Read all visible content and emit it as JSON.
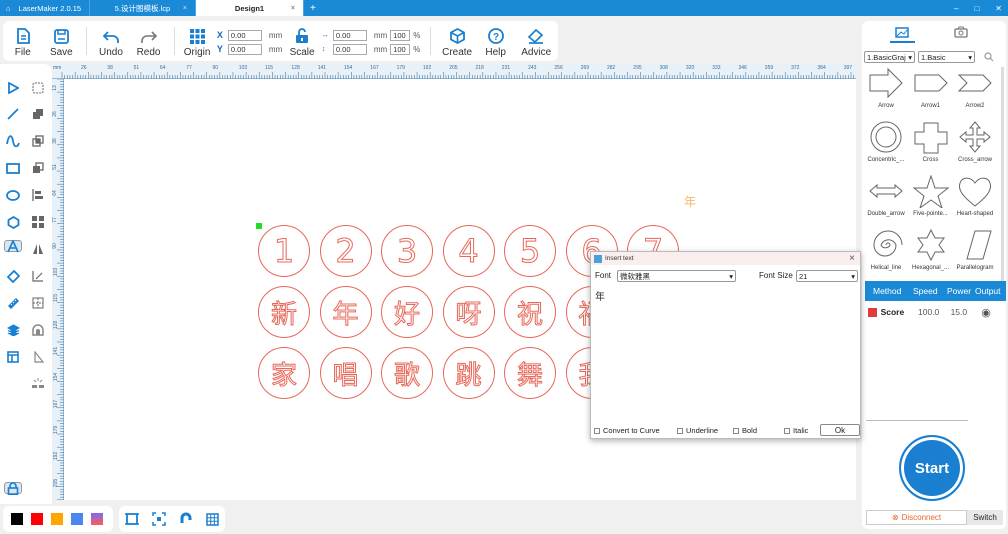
{
  "titlebar": {
    "app_name": "LaserMaker 2.0.15",
    "tabs": [
      {
        "label": "5.设计图模板.lcp",
        "close": "×"
      },
      {
        "label": "Design1",
        "close": "×"
      }
    ],
    "add_tab": "+",
    "window_controls": {
      "minimize": "–",
      "maximize": "□",
      "close": "✕"
    }
  },
  "toolbar": {
    "file": "File",
    "save": "Save",
    "undo": "Undo",
    "redo": "Redo",
    "origin": "Origin",
    "x_label": "X",
    "x_value": "0.00",
    "y_label": "Y",
    "y_value": "0.00",
    "unit": "mm",
    "scale": "Scale",
    "width_value": "0.00",
    "height_value": "0.00",
    "width_pct": "100",
    "height_pct": "100",
    "pct": "%",
    "create": "Create",
    "help": "Help",
    "advice": "Advice"
  },
  "ruler": {
    "unit": "mm",
    "top_labels": [
      "26",
      "38",
      "51",
      "64",
      "77",
      "90",
      "103",
      "115",
      "128",
      "141",
      "154",
      "167",
      "179",
      "192",
      "205",
      "218",
      "231",
      "243",
      "256",
      "269",
      "282",
      "295",
      "308",
      "320",
      "333",
      "346",
      "359",
      "372",
      "384",
      "397"
    ],
    "left_labels": [
      "13",
      "26",
      "38",
      "51",
      "64",
      "77",
      "90",
      "103",
      "115",
      "128",
      "141",
      "154",
      "167",
      "179",
      "192",
      "205"
    ]
  },
  "canvas": {
    "rows": [
      [
        "1",
        "2",
        "3",
        "4",
        "5",
        "6",
        "7"
      ],
      [
        "新",
        "年",
        "好",
        "呀",
        "祝",
        "福"
      ],
      [
        "家",
        "唱",
        "歌",
        "跳",
        "舞",
        "我"
      ]
    ],
    "preview_char": "年",
    "accent_stroke": "#e8685a"
  },
  "colors": {
    "swatches": [
      "#000000",
      "#ff0000",
      "#ffa500",
      "#4a86f0",
      "gradient"
    ]
  },
  "right_panel": {
    "library_select": "1.BasicGraj",
    "category_select": "1.Basic",
    "shapes": [
      "Arrow",
      "Arrow1",
      "Arrow2",
      "Concentric_...",
      "Cross",
      "Cross_arrow",
      "Double_arrow",
      "Five-pointe...",
      "Heart-shaped",
      "Helical_line",
      "Hexagonal_...",
      "Parallelogram"
    ],
    "layers": {
      "headers": [
        "Method",
        "Speed",
        "Power",
        "Output"
      ],
      "rows": [
        {
          "color": "#e03a3a",
          "method": "Score",
          "speed": "100.0",
          "power": "15.0"
        }
      ]
    },
    "start": "Start",
    "disconnect": "Disconnect",
    "switch": "Switch"
  },
  "dialog": {
    "title": "Insert text",
    "font_label": "Font",
    "font_value": "微软雅黑",
    "font_size_label": "Font Size",
    "font_size_value": "21",
    "text": "年",
    "convert": "Convert to Curve",
    "underline": "Underline",
    "bold": "Bold",
    "italic": "Italic",
    "ok": "Ok",
    "close": "×"
  }
}
